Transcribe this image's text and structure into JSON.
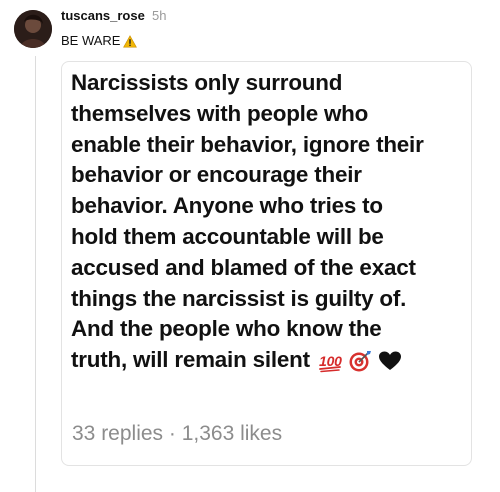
{
  "post": {
    "username": "tuscans_rose",
    "timestamp": "5h",
    "caption": "BE WARE",
    "caption_icon": "warning-icon"
  },
  "card": {
    "lines": [
      "Narcissists only surround",
      "themselves with people who",
      "enable their behavior, ignore their",
      "behavior or encourage their",
      "behavior. Anyone who tries to",
      "hold them accountable will be",
      "accused and blamed of the exact",
      "things the narcissist is guilty of.",
      "And the people who know the",
      "truth, will remain silent"
    ],
    "emojis": [
      "hundred-points-icon",
      "direct-hit-icon",
      "black-heart-icon"
    ],
    "stats": "33 replies · 1,363 likes"
  },
  "colors": {
    "warning": "#f2b705",
    "hundred": "#d62b2b",
    "target_red": "#d8322f",
    "heart": "#111111",
    "muted": "#8c8c8c"
  }
}
